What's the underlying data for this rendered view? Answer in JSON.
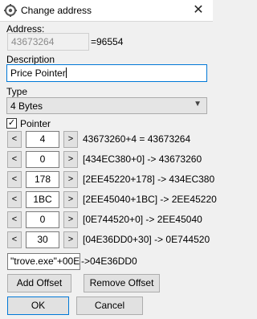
{
  "window": {
    "title": "Change address",
    "close_glyph": "✕"
  },
  "address": {
    "label": "Address:",
    "value": "43673264",
    "equals_text": "=96554"
  },
  "description": {
    "label": "Description",
    "value": "Price Pointer"
  },
  "type": {
    "label": "Type",
    "selected": "4 Bytes"
  },
  "pointer": {
    "label": "Pointer",
    "checked": true
  },
  "pointer_rows": [
    {
      "offset": "4",
      "desc": "43673260+4 = 43673264"
    },
    {
      "offset": "0",
      "desc": "[434EC380+0] -> 43673260"
    },
    {
      "offset": "178",
      "desc": "[2EE45220+178] -> 434EC380"
    },
    {
      "offset": "1BC",
      "desc": "[2EE45040+1BC] -> 2EE45220"
    },
    {
      "offset": "0",
      "desc": "[0E744520+0] -> 2EE45040"
    },
    {
      "offset": "30",
      "desc": "[04E36DD0+30] -> 0E744520"
    }
  ],
  "base": {
    "value": "\"trove.exe\"+00E",
    "desc": "->04E36DD0"
  },
  "buttons": {
    "decrease": "<",
    "increase": ">",
    "add_offset": "Add Offset",
    "remove_offset": "Remove Offset",
    "ok": "OK",
    "cancel": "Cancel"
  },
  "icons": {
    "app": "cheat-engine-icon",
    "checkbox_check": "✓",
    "dropdown": "chevron-down-icon"
  },
  "colors": {
    "focus_border": "#0078d7",
    "button_bg": "#e1e1e1",
    "window_bg": "#f0f0f0"
  }
}
